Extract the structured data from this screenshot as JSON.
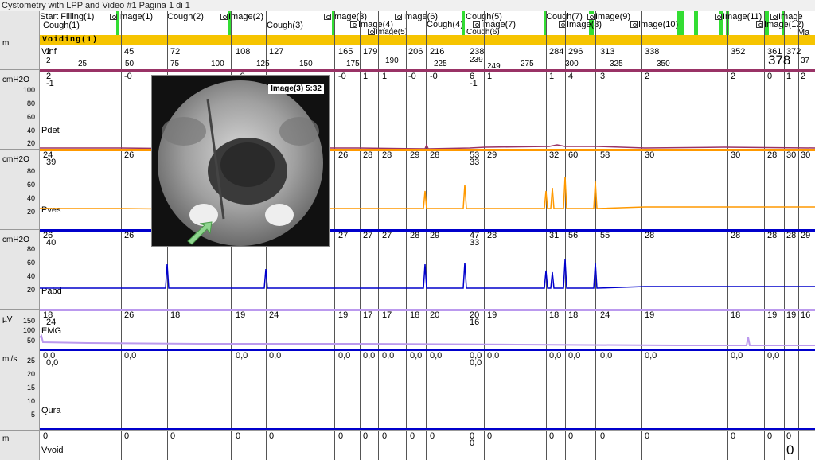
{
  "window": {
    "title": "Cystometry with LPP and Video #1 Pagina 1 di 1"
  },
  "events": [
    {
      "label": "Start Filling(1)",
      "cam": false
    },
    {
      "label": "Cough(1)",
      "cam": false
    },
    {
      "label": "Image(1)",
      "cam": true
    },
    {
      "label": "Cough(2)",
      "cam": false
    },
    {
      "label": "Image(2)",
      "cam": true
    },
    {
      "label": "Cough(3)",
      "cam": false
    },
    {
      "label": "Image(3)",
      "cam": true
    },
    {
      "label": "Image(4)",
      "cam": true
    },
    {
      "label": "Image(5)",
      "cam": true
    },
    {
      "label": "Image(6)",
      "cam": true
    },
    {
      "label": "Cough(4)",
      "cam": false
    },
    {
      "label": "Cough(5)",
      "cam": false
    },
    {
      "label": "Image(7)",
      "cam": true
    },
    {
      "label": "Cough(6)",
      "cam": false
    },
    {
      "label": "Cough(7)",
      "cam": false
    },
    {
      "label": "Image(8)",
      "cam": true
    },
    {
      "label": "Image(9)",
      "cam": true
    },
    {
      "label": "Image(10)",
      "cam": true
    },
    {
      "label": "Image(11)",
      "cam": true
    },
    {
      "label": "Image(12)",
      "cam": true
    },
    {
      "label": "Image",
      "cam": true
    },
    {
      "label": "Ma",
      "cam": false
    }
  ],
  "voiding": {
    "label": "Voiding(1)"
  },
  "vinf": {
    "unit": "ml",
    "label": "Vinf",
    "values": [
      "2",
      "45",
      "72",
      "108",
      "127",
      "165",
      "179",
      "206",
      "216",
      "238",
      "284",
      "296",
      "313",
      "338",
      "352",
      "361",
      "372"
    ],
    "scale": [
      "2",
      "25",
      "50",
      "75",
      "100",
      "125",
      "150",
      "175",
      "190",
      "225",
      "239",
      "249",
      "275",
      "300",
      "325",
      "350",
      "37"
    ],
    "current": "378"
  },
  "channels": [
    {
      "name": "Pdet",
      "unit": "cmH2O",
      "ticks": [
        "100",
        "80",
        "60",
        "40",
        "20"
      ],
      "color": "#993366",
      "values": [
        "2",
        "-1",
        "-0",
        "-0",
        "-0",
        "1",
        "1",
        "-0",
        "-0",
        "6",
        "-1",
        "1",
        "1",
        "4",
        "3",
        "2",
        "2",
        "0",
        "1",
        "2"
      ]
    },
    {
      "name": "Pves",
      "unit": "cmH2O",
      "ticks": [
        "80",
        "60",
        "40",
        "20"
      ],
      "color": "#ff9900",
      "values": [
        "24",
        "39",
        "26",
        "26",
        "28",
        "28",
        "29",
        "28",
        "53",
        "33",
        "29",
        "32",
        "60",
        "58",
        "30",
        "30",
        "28",
        "30",
        "30"
      ]
    },
    {
      "name": "Pabd",
      "unit": "cmH2O",
      "ticks": [
        "80",
        "60",
        "40",
        "20"
      ],
      "color": "#0000cc",
      "values": [
        "26",
        "40",
        "26",
        "27",
        "27",
        "27",
        "28",
        "29",
        "47",
        "33",
        "28",
        "31",
        "56",
        "55",
        "28",
        "28",
        "28",
        "28",
        "29"
      ]
    },
    {
      "name": "EMG",
      "unit": "µV",
      "ticks": [
        "150",
        "100",
        "50"
      ],
      "color": "#bb99ee",
      "values": [
        "18",
        "24",
        "26",
        "18",
        "19",
        "24",
        "19",
        "17",
        "17",
        "18",
        "20",
        "20",
        "16",
        "19",
        "18",
        "18",
        "24",
        "19",
        "18",
        "19",
        "19",
        "16"
      ]
    },
    {
      "name": "Qura",
      "unit": "ml/s",
      "ticks": [
        "25",
        "20",
        "15",
        "10",
        "5"
      ],
      "color": "#0000cc",
      "values": [
        "0,0",
        "0,0",
        "0,0",
        "0,0",
        "0,0",
        "0,0",
        "0,0",
        "0,0",
        "0,0",
        "0,0",
        "0,0",
        "0,0",
        "0,0",
        "0,0",
        "0,0",
        "0,0",
        "0,0",
        "0,0",
        "0,0"
      ]
    },
    {
      "name": "Vvoid",
      "unit": "ml",
      "ticks": [],
      "color": "#0000cc",
      "values": [
        "0",
        "0",
        "0",
        "0",
        "0",
        "0",
        "0",
        "0",
        "0",
        "0",
        "0",
        "0",
        "0",
        "0",
        "0",
        "0",
        "0",
        "0",
        "0",
        "0"
      ],
      "current": "0"
    }
  ],
  "popup": {
    "title": "Image(3)  5:32"
  }
}
